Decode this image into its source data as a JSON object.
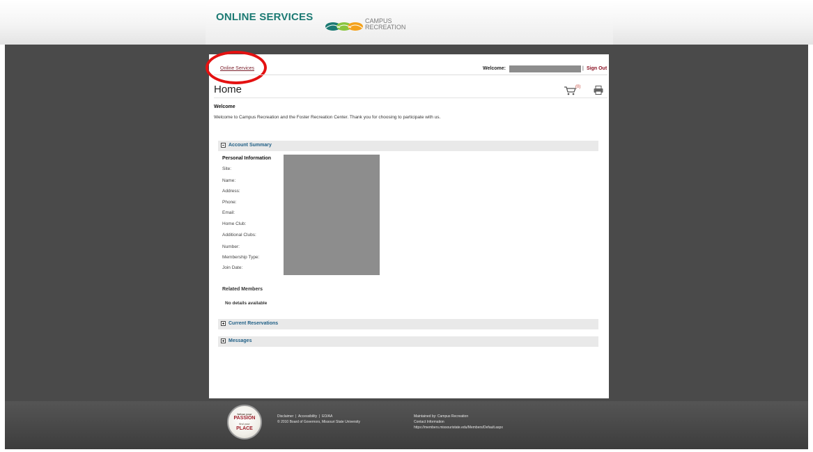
{
  "header": {
    "brand_title": "ONLINE SERVICES",
    "logo_line1": "CAMPUS",
    "logo_line2": "RECREATION",
    "colors": {
      "brand": "#1c7a73",
      "accent": "#8a1022"
    }
  },
  "topbar": {
    "breadcrumb": "Online Services",
    "welcome_label": "Welcome:",
    "separator": "|",
    "sign_out": "Sign Out"
  },
  "page": {
    "title": "Home",
    "cart_count": "(0)",
    "welcome_heading": "Welcome",
    "welcome_text": "Welcome to Campus Recreation and the Foster Recreation Center. Thank you for choosing to participate with us."
  },
  "account_summary": {
    "title": "Account Summary",
    "personal_heading": "Personal Information",
    "fields": [
      "Site:",
      "Name:",
      "Address:",
      "Phone:",
      "Email:",
      "Home Club:",
      "Additional Clubs:",
      "Number:",
      "Membership Type:",
      "Join Date:"
    ],
    "related_heading": "Related Members",
    "no_details": "No details available"
  },
  "sections": {
    "current_reservations": "Current Reservations",
    "messages": "Messages"
  },
  "footer": {
    "badge_line1": "follow your",
    "badge_line2": "PASSION",
    "badge_line3": "find your",
    "badge_line4": "PLACE",
    "links": [
      "Disclaimer",
      "Accessibility",
      "EO/AA"
    ],
    "link_separator": "|",
    "copyright": "© 2010 Board of Governors, Missouri State University",
    "maintained_by": "Maintained by: Campus Recreation",
    "contact": "Contact Information",
    "url": "https://members.missouristate.edu/Members/Default.aspx"
  },
  "icons": [
    "cart-icon",
    "printer-icon",
    "collapse-icon",
    "expand-icon",
    "campus-recreation-logo"
  ]
}
